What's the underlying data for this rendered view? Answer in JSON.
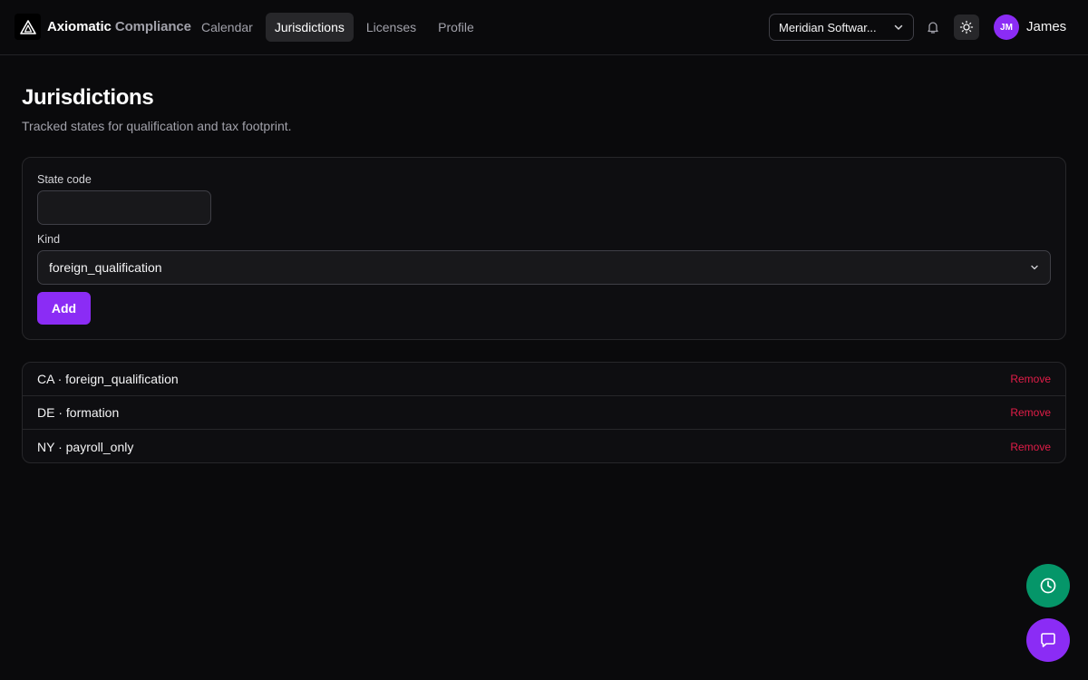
{
  "header": {
    "brand_primary": "Axiomatic",
    "brand_secondary": "Compliance",
    "nav": [
      {
        "label": "Calendar",
        "active": false
      },
      {
        "label": "Jurisdictions",
        "active": true
      },
      {
        "label": "Licenses",
        "active": false
      },
      {
        "label": "Profile",
        "active": false
      }
    ],
    "org_select": "Meridian Softwar...",
    "user_initials": "JM",
    "user_name": "James"
  },
  "page": {
    "title": "Jurisdictions",
    "subtitle": "Tracked states for qualification and tax footprint."
  },
  "form": {
    "state_code_label": "State code",
    "state_code_value": "",
    "kind_label": "Kind",
    "kind_value": "foreign_qualification",
    "add_label": "Add"
  },
  "jurisdictions": [
    {
      "text": "CA · foreign_qualification",
      "action": "Remove"
    },
    {
      "text": "DE · formation",
      "action": "Remove"
    },
    {
      "text": "NY · payroll_only",
      "action": "Remove"
    }
  ],
  "colors": {
    "accent": "#8b2cf5",
    "danger": "#e11d48",
    "success": "#059669",
    "background": "#0a0a0c"
  },
  "icons": {
    "logo": "triangle-logo-icon",
    "org_chevron": "chevron-down-icon",
    "notifications": "bell-icon",
    "theme": "sun-icon",
    "select_chevron": "chevron-down-icon",
    "fab_1": "clock-icon",
    "fab_2": "chat-icon"
  }
}
